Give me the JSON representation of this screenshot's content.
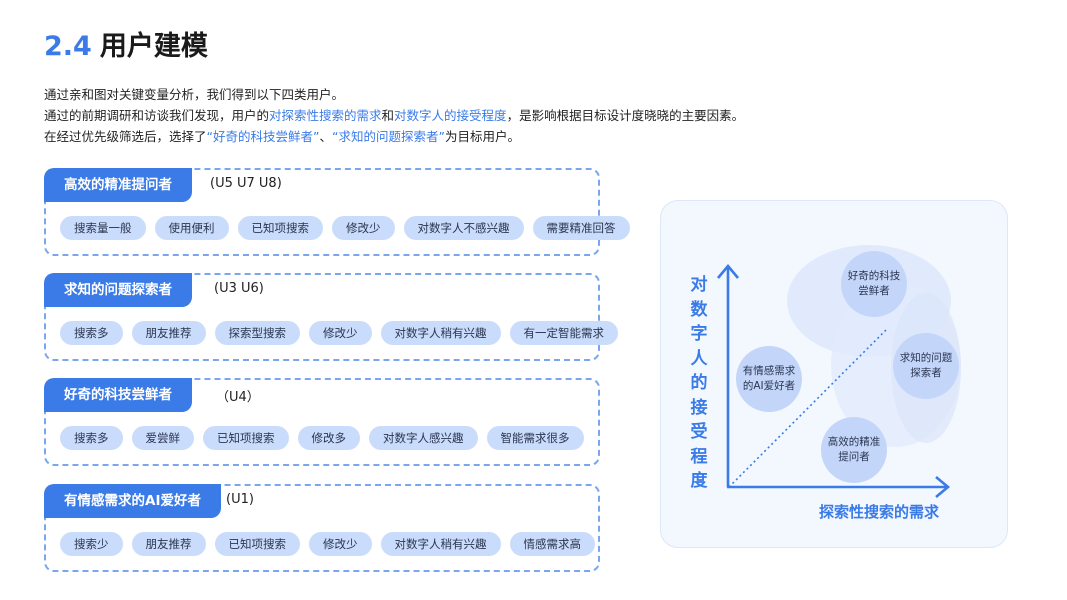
{
  "header": {
    "number": "2.4",
    "title": "用户建模"
  },
  "intro": {
    "line1": "通过亲和图对关键变量分析，我们得到以下四类用户。",
    "line2_a": "通过的前期调研和访谈我们发现，用户的",
    "line2_hl1": "对探索性搜索的需求",
    "line2_b": "和",
    "line2_hl2": "对数字人的接受程度",
    "line2_c": "，是影响根据目标设计度晓晓的主要因素。",
    "line3_a": "在经过优先级筛选后，选择了",
    "line3_hl1": "“好奇的科技尝鲜者”",
    "line3_b": "、",
    "line3_hl2": "“求知的问题探索者”",
    "line3_c": "为目标用户。"
  },
  "groups": [
    {
      "name": "高效的精准提问者",
      "users": "(U5  U7  U8)",
      "tags": [
        "搜索量一般",
        "使用便利",
        "已知项搜索",
        "修改少",
        "对数字人不感兴趣",
        "需要精准回答"
      ]
    },
    {
      "name": "求知的问题探索者",
      "users": "(U3 U6)",
      "tags": [
        "搜索多",
        "朋友推荐",
        "探索型搜索",
        "修改少",
        "对数字人稍有兴趣",
        "有一定智能需求"
      ]
    },
    {
      "name": "好奇的科技尝鲜者",
      "users": "（U4）",
      "tags": [
        "搜索多",
        "爱尝鲜",
        "已知项搜索",
        "修改多",
        "对数字人感兴趣",
        "智能需求很多"
      ]
    },
    {
      "name": "有情感需求的AI爱好者",
      "users": "(U1)",
      "tags": [
        "搜索少",
        "朋友推荐",
        "已知项搜索",
        "修改少",
        "对数字人稍有兴趣",
        "情感需求高"
      ]
    }
  ],
  "diagram": {
    "y_axis_label": "对数字人的接受程度",
    "x_axis_label": "探索性搜索的需求",
    "personas": [
      {
        "name": "好奇的科技尝鲜者"
      },
      {
        "name": "求知的问题探索者"
      },
      {
        "name": "有情感需求的AI爱好者"
      },
      {
        "name": "高效的精准提问者"
      }
    ],
    "colors": {
      "accent": "#3a7be8",
      "circle": "#c3d6fa",
      "tag": "#c9dcfb"
    }
  }
}
